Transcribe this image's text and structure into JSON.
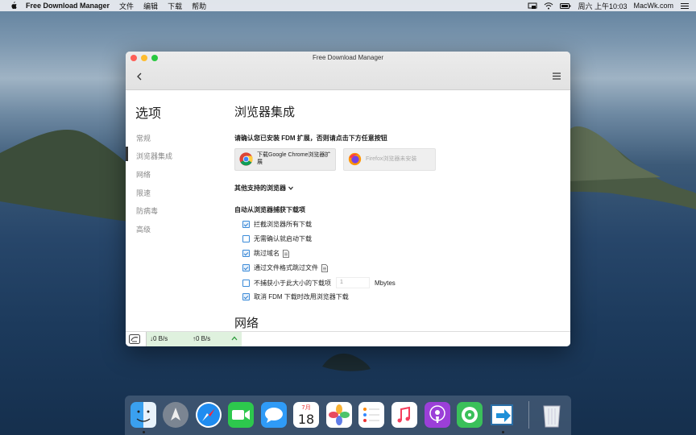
{
  "menubar": {
    "app_name": "Free Download Manager",
    "menus": [
      "文件",
      "编辑",
      "下载",
      "帮助"
    ],
    "clock": "周六 上午10:03",
    "site": "MacWk.com"
  },
  "window": {
    "title": "Free Download Manager"
  },
  "sidebar": {
    "title": "选项",
    "items": [
      {
        "label": "常规",
        "active": false
      },
      {
        "label": "浏览器集成",
        "active": true
      },
      {
        "label": "网络",
        "active": false
      },
      {
        "label": "限速",
        "active": false
      },
      {
        "label": "防病毒",
        "active": false
      },
      {
        "label": "高级",
        "active": false
      }
    ]
  },
  "content": {
    "section_title": "浏览器集成",
    "instruction": "请确认您已安装 FDM 扩展，否则请点击下方任意按钮",
    "chrome_button": "下载Google Chrome浏览器扩展",
    "firefox_button": "Firefox浏览器未安装",
    "other_browsers": "其他支持的浏览器",
    "capture_heading": "自动从浏览器捕获下载项",
    "options": [
      {
        "label": "拦截浏览器所有下载",
        "checked": true
      },
      {
        "label": "无需确认就启动下载",
        "checked": false
      },
      {
        "label": "跳过域名",
        "checked": true
      },
      {
        "label": "通过文件格式跳过文件",
        "checked": true
      },
      {
        "label": "不捕获小于此大小的下载项",
        "checked": false
      },
      {
        "label": "取消 FDM 下载时改用浏览器下载",
        "checked": true
      }
    ],
    "size_value": "1",
    "size_unit": "Mbytes",
    "next_section": "网络"
  },
  "status": {
    "download_speed": "↓0 B/s",
    "upload_speed": "↑0 B/s"
  },
  "colors": {
    "accent": "#3a8ad8",
    "speed_bg": "#dff1de"
  },
  "dock": {
    "icons": [
      "finder-icon",
      "launchpad-icon",
      "safari-icon",
      "facetime-icon",
      "messages-icon",
      "calendar-icon",
      "photos-icon",
      "reminders-icon",
      "music-icon",
      "podcasts-icon",
      "findmy-icon",
      "fdm-dock-icon",
      "trash-icon"
    ],
    "calendar_month": "7月",
    "calendar_day": "18"
  }
}
